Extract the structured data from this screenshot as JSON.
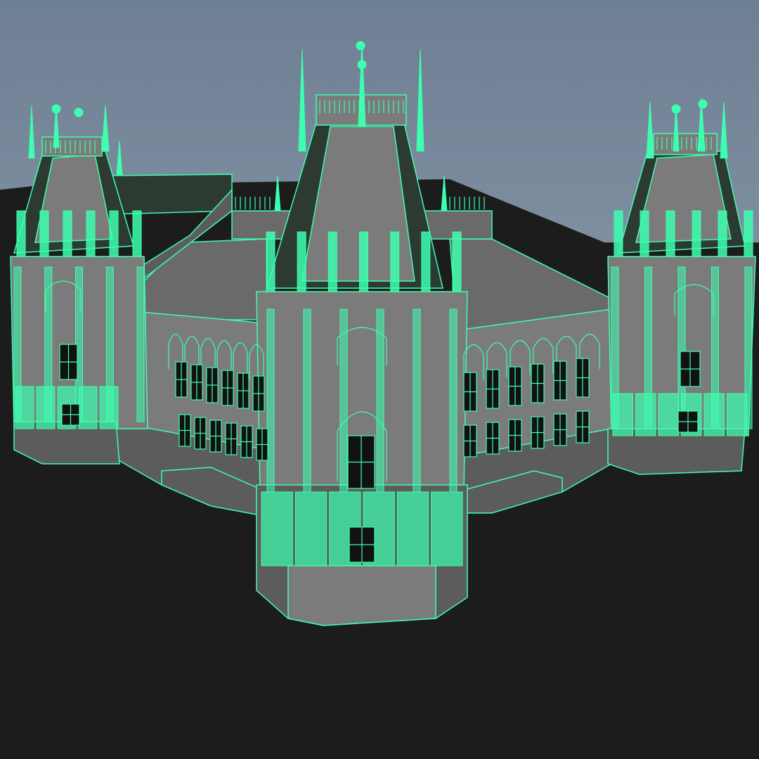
{
  "viewport": {
    "display_mode": "wireframe-on-shaded",
    "selected_object": "palace",
    "colors": {
      "sky_top": "#6e7f93",
      "sky_bottom": "#8898aa",
      "ground": "#1c1c1c",
      "wire": "#3dffb0",
      "shade": "#7b7b7b",
      "shade_dark": "#5c5c5c",
      "roof": "#6a6a6a",
      "roof_dark": "#2c3a32",
      "window": "#111111"
    }
  }
}
